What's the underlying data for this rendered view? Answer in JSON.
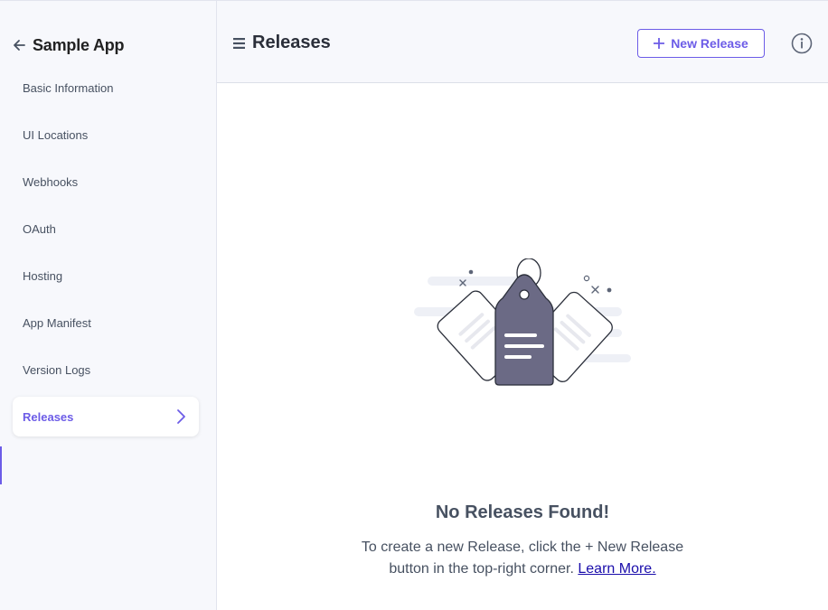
{
  "sidebar": {
    "app_title": "Sample App",
    "items": [
      {
        "label": "Basic Information"
      },
      {
        "label": "UI Locations"
      },
      {
        "label": "Webhooks"
      },
      {
        "label": "OAuth"
      },
      {
        "label": "Hosting"
      },
      {
        "label": "App Manifest"
      },
      {
        "label": "Version Logs"
      },
      {
        "label": "Releases",
        "active": true
      }
    ]
  },
  "header": {
    "title": "Releases",
    "new_release_label": "New Release"
  },
  "empty_state": {
    "title": "No Releases Found!",
    "description": "To create a new Release, click the + New Release button in the top-right corner.",
    "link_label": "Learn More."
  },
  "colors": {
    "accent": "#6c5ce7",
    "tag_fill": "#6b6a85",
    "text_muted": "#475161",
    "sidebar_bg": "#f7f8fc"
  },
  "icons": {
    "back": "arrow-left-icon",
    "menu": "hamburger-icon",
    "plus": "plus-icon",
    "info": "info-icon",
    "chevron": "chevron-right-icon"
  }
}
